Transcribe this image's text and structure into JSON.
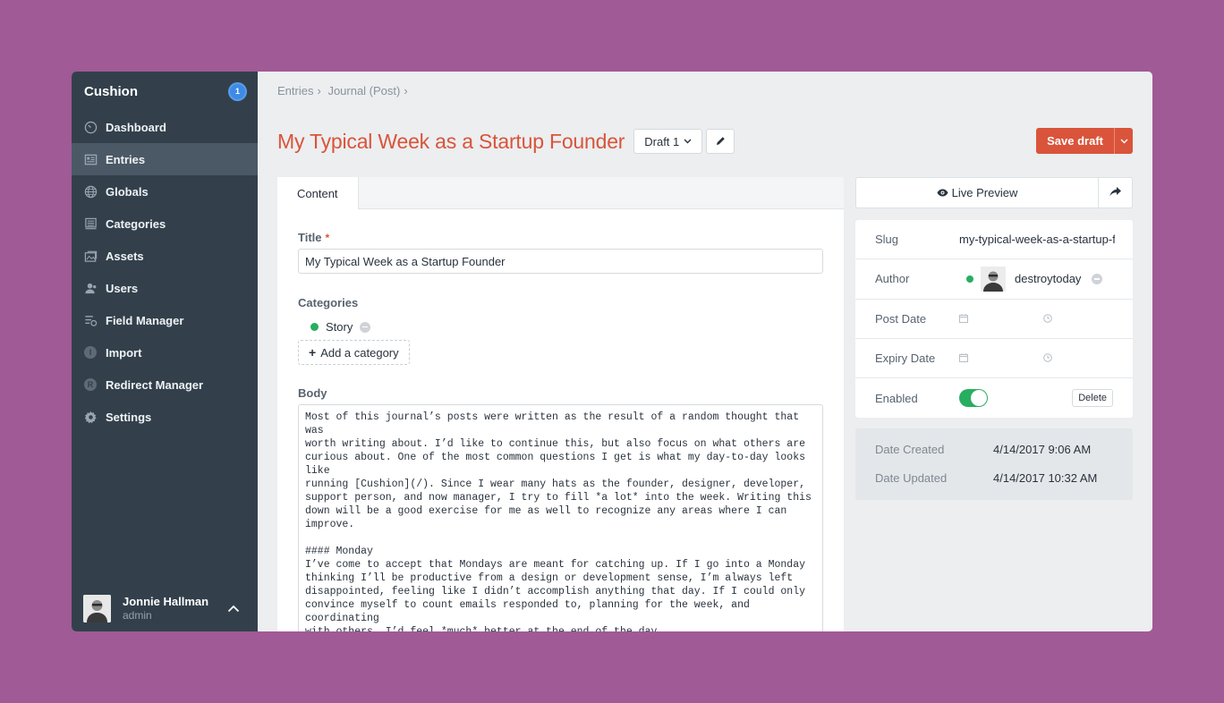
{
  "sidebar": {
    "brand": "Cushion",
    "badge": "1",
    "items": [
      {
        "label": "Dashboard",
        "icon": "dashboard-icon"
      },
      {
        "label": "Entries",
        "icon": "entries-icon"
      },
      {
        "label": "Globals",
        "icon": "globe-icon"
      },
      {
        "label": "Categories",
        "icon": "categories-icon"
      },
      {
        "label": "Assets",
        "icon": "assets-icon"
      },
      {
        "label": "Users",
        "icon": "users-icon"
      },
      {
        "label": "Field Manager",
        "icon": "field-manager-icon"
      },
      {
        "label": "Import",
        "icon": "I"
      },
      {
        "label": "Redirect Manager",
        "icon": "R"
      },
      {
        "label": "Settings",
        "icon": "gear-icon"
      }
    ],
    "active_index": 1,
    "user": {
      "name": "Jonnie Hallman",
      "role": "admin"
    }
  },
  "breadcrumb": [
    "Entries",
    "Journal (Post)"
  ],
  "header": {
    "title": "My Typical Week as a Startup Founder",
    "draft_label": "Draft 1",
    "save_label": "Save draft"
  },
  "content": {
    "tab": "Content",
    "title_label": "Title",
    "required_mark": "*",
    "title_value": "My Typical Week as a Startup Founder",
    "categories_label": "Categories",
    "category": "Story",
    "add_category": "Add a category",
    "body_label": "Body",
    "body_value": "Most of this journal’s posts were written as the result of a random thought that was\nworth writing about. I’d like to continue this, but also focus on what others are\ncurious about. One of the most common questions I get is what my day-to-day looks like\nrunning [Cushion](/). Since I wear many hats as the founder, designer, developer,\nsupport person, and now manager, I try to fill *a lot* into the week. Writing this\ndown will be a good exercise for me as well to recognize any areas where I can\nimprove.\n\n#### Monday\nI’ve come to accept that Mondays are meant for catching up. If I go into a Monday\nthinking I’ll be productive from a design or development sense, I’m always left\ndisappointed, feeling like I didn’t accomplish anything that day. If I could only\nconvince myself to count emails responded to, planning for the week, and coordinating\nwith others, I’d feel *much* better at the end of the day.\n\n![Intercom]()"
  },
  "sidepanel": {
    "live_preview": "Live Preview",
    "slug_label": "Slug",
    "slug_value": "my-typical-week-as-a-startup-founder",
    "author_label": "Author",
    "author_value": "destroytoday",
    "post_date_label": "Post Date",
    "expiry_date_label": "Expiry Date",
    "enabled_label": "Enabled",
    "enabled": true,
    "delete_label": "Delete",
    "date_created_label": "Date Created",
    "date_created": "4/14/2017 9:06 AM",
    "date_updated_label": "Date Updated",
    "date_updated": "4/14/2017 10:32 AM"
  },
  "colors": {
    "background": "#a05a96",
    "sidebar": "#33404c",
    "accent": "#d9543a",
    "status_green": "#27ae60",
    "badge_blue": "#3f8ae6"
  }
}
